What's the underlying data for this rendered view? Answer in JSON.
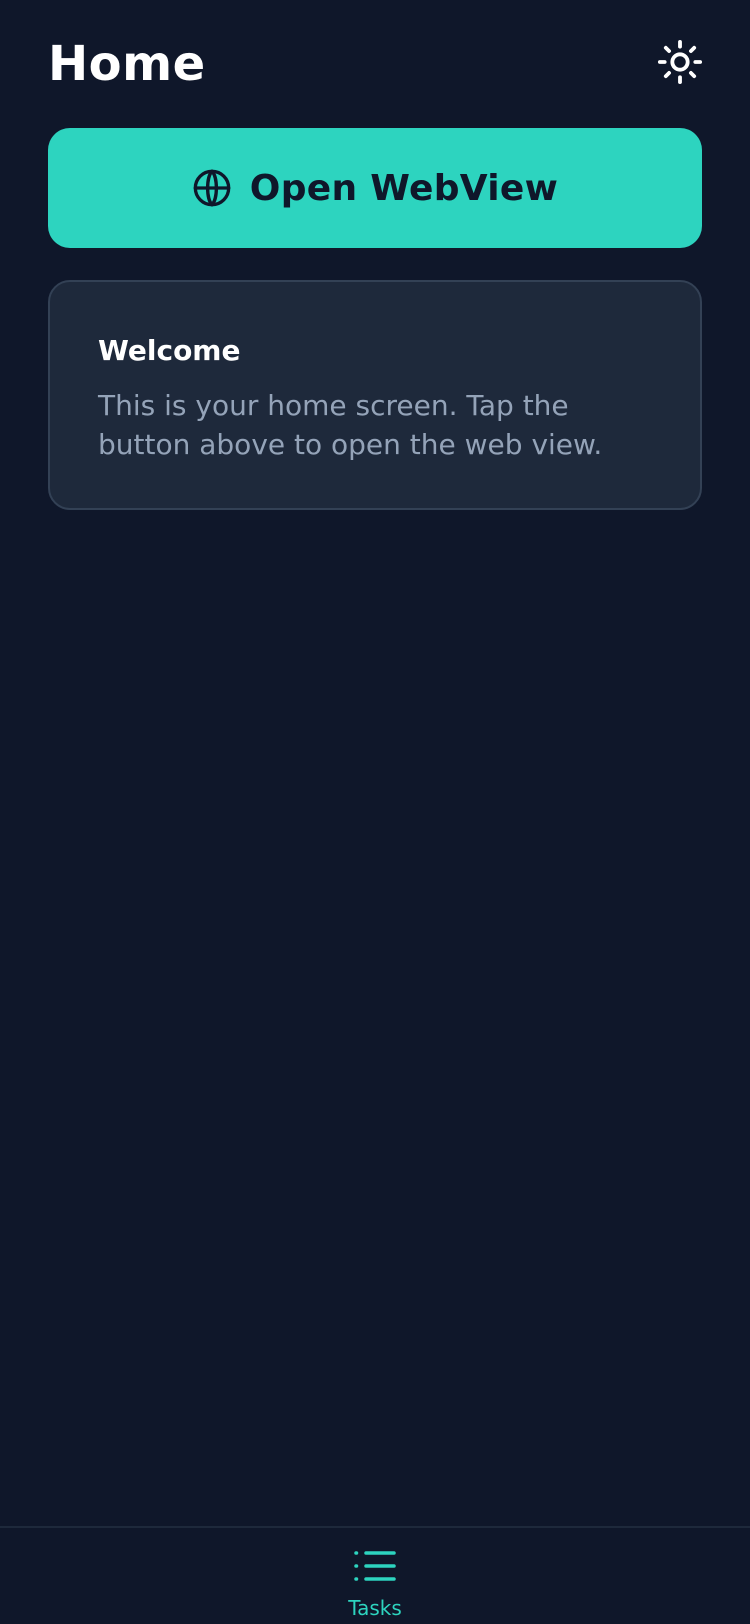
{
  "header": {
    "title": "Home",
    "theme_toggle_icon": "sun-icon"
  },
  "primary_action": {
    "label": "Open WebView",
    "icon": "globe-icon"
  },
  "welcome_card": {
    "title": "Welcome",
    "body": "This is your home screen. Tap the button above to open the web view."
  },
  "tab_bar": {
    "tabs": [
      {
        "label": "Tasks",
        "icon": "list-icon",
        "active": true
      }
    ]
  },
  "colors": {
    "background": "#0f172a",
    "accent": "#2dd4bf",
    "card": "#1e293b",
    "card_border": "#334155",
    "muted_text": "#94a3b8"
  }
}
